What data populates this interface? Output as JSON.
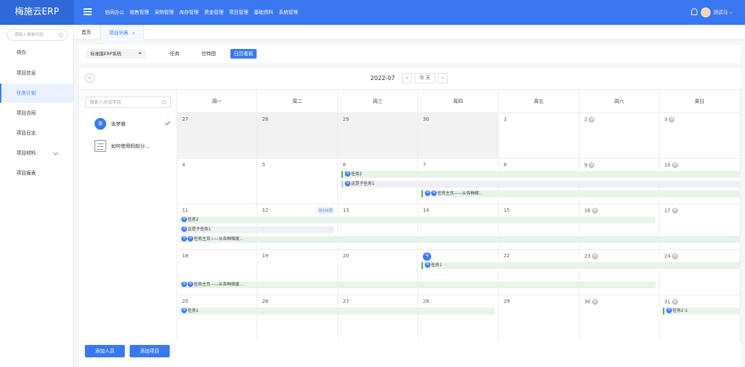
{
  "app": {
    "logo": "梅施云ERP"
  },
  "top_nav": [
    "协同办公",
    "销售管理",
    "采购管理",
    "库存管理",
    "资金管理",
    "项目管理",
    "基础资料",
    "系统管理"
  ],
  "user": {
    "name": "测试马"
  },
  "sidebar": {
    "search_placeholder": "请输入搜索内容",
    "items": [
      "待办",
      "项目信息",
      "任务计划",
      "项目合同",
      "项目日志",
      "项目材料",
      "项目报表"
    ]
  },
  "tabs": {
    "home": "首页",
    "project_list": "项目列表",
    "close": "×"
  },
  "toolbar": {
    "system": "标准版ERP系统",
    "views": [
      "任务",
      "甘特图",
      "日历看板"
    ]
  },
  "calendar": {
    "collapse": "«",
    "month": "2022-07",
    "prev": "‹",
    "today": "今 天",
    "next": "›",
    "weekdays": [
      "周一",
      "周二",
      "周三",
      "周四",
      "周五",
      "周六",
      "周日"
    ],
    "today_marker": "今",
    "holiday_marker": "休",
    "week2_more": "共计5项"
  },
  "left_panel": {
    "search_placeholder": "搜索人员或项目",
    "person": {
      "avatar": "张",
      "name": "张梦雅"
    },
    "project": "如何使用蚂蚁分...",
    "add_person": "添加人员",
    "add_project": "添加项目"
  },
  "days": [
    [
      "27",
      "28",
      "29",
      "30",
      "1",
      "2",
      "3"
    ],
    [
      "4",
      "5",
      "6",
      "7",
      "8",
      "9",
      "10"
    ],
    [
      "11",
      "12",
      "13",
      "14",
      "15",
      "16",
      "17"
    ],
    [
      "18",
      "19",
      "20",
      "",
      "22",
      "23",
      "24"
    ],
    [
      "25",
      "26",
      "27",
      "28",
      "29",
      "30",
      "31"
    ]
  ],
  "events": {
    "task2": "任务2",
    "subtask1": "这是子任务1",
    "main_page": "任务主页——从各种维...",
    "main_page_b": "任务主页——从各种维度...",
    "task1": "任务1",
    "task2_1": "任务2-1",
    "avatar": "张"
  }
}
